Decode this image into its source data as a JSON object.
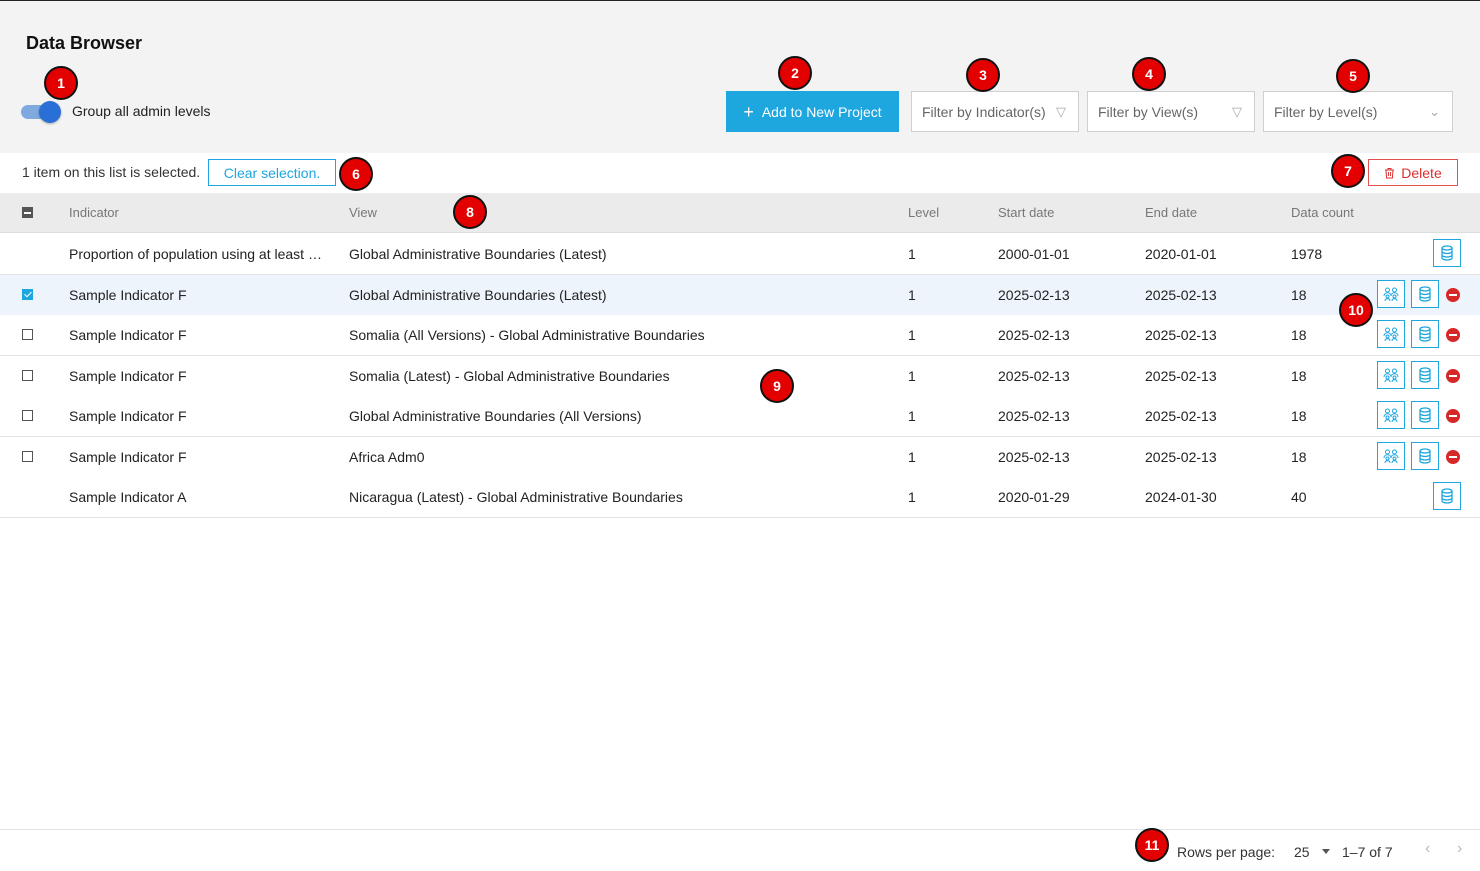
{
  "header": {
    "title": "Data Browser",
    "toggle_label": "Group all admin levels",
    "add_button": "Add to New Project",
    "filter_indicator": "Filter by Indicator(s)",
    "filter_view": "Filter by View(s)",
    "filter_level": "Filter by Level(s)"
  },
  "selection": {
    "text": "1 item on this list is selected.",
    "clear_label": "Clear selection.",
    "delete_label": "Delete"
  },
  "table": {
    "columns": [
      "Indicator",
      "View",
      "Level",
      "Start date",
      "End date",
      "Data count"
    ],
    "rows": [
      {
        "indicator": "Proportion of population using at least basic drinking water services",
        "view": "Global Administrative Boundaries (Latest)",
        "level": "1",
        "start": "2000-01-01",
        "end": "2020-01-01",
        "count": "1978"
      },
      {
        "indicator": "Sample Indicator F",
        "view": "Global Administrative Boundaries (Latest)",
        "level": "1",
        "start": "2025-02-13",
        "end": "2025-02-13",
        "count": "18"
      },
      {
        "indicator": "Sample Indicator F",
        "view": "Somalia (All Versions) - Global Administrative Boundaries",
        "level": "1",
        "start": "2025-02-13",
        "end": "2025-02-13",
        "count": "18"
      },
      {
        "indicator": "Sample Indicator F",
        "view": "Somalia (Latest) - Global Administrative Boundaries",
        "level": "1",
        "start": "2025-02-13",
        "end": "2025-02-13",
        "count": "18"
      },
      {
        "indicator": "Sample Indicator F",
        "view": "Global Administrative Boundaries (All Versions)",
        "level": "1",
        "start": "2025-02-13",
        "end": "2025-02-13",
        "count": "18"
      },
      {
        "indicator": "Sample Indicator F",
        "view": "Africa Adm0",
        "level": "1",
        "start": "2025-02-13",
        "end": "2025-02-13",
        "count": "18"
      },
      {
        "indicator": "Sample Indicator A",
        "view": "Nicaragua (Latest) - Global Administrative Boundaries",
        "level": "1",
        "start": "2020-01-29",
        "end": "2024-01-30",
        "count": "40"
      }
    ]
  },
  "footer": {
    "rows_per_page_label": "Rows per page:",
    "rows_per_page": "25",
    "range": "1–7 of 7"
  },
  "markers": [
    "1",
    "2",
    "3",
    "4",
    "5",
    "6",
    "7",
    "8",
    "9",
    "10",
    "11"
  ],
  "colors": {
    "accent": "#1ea6df",
    "danger": "#d62828",
    "marker": "#e30000"
  }
}
